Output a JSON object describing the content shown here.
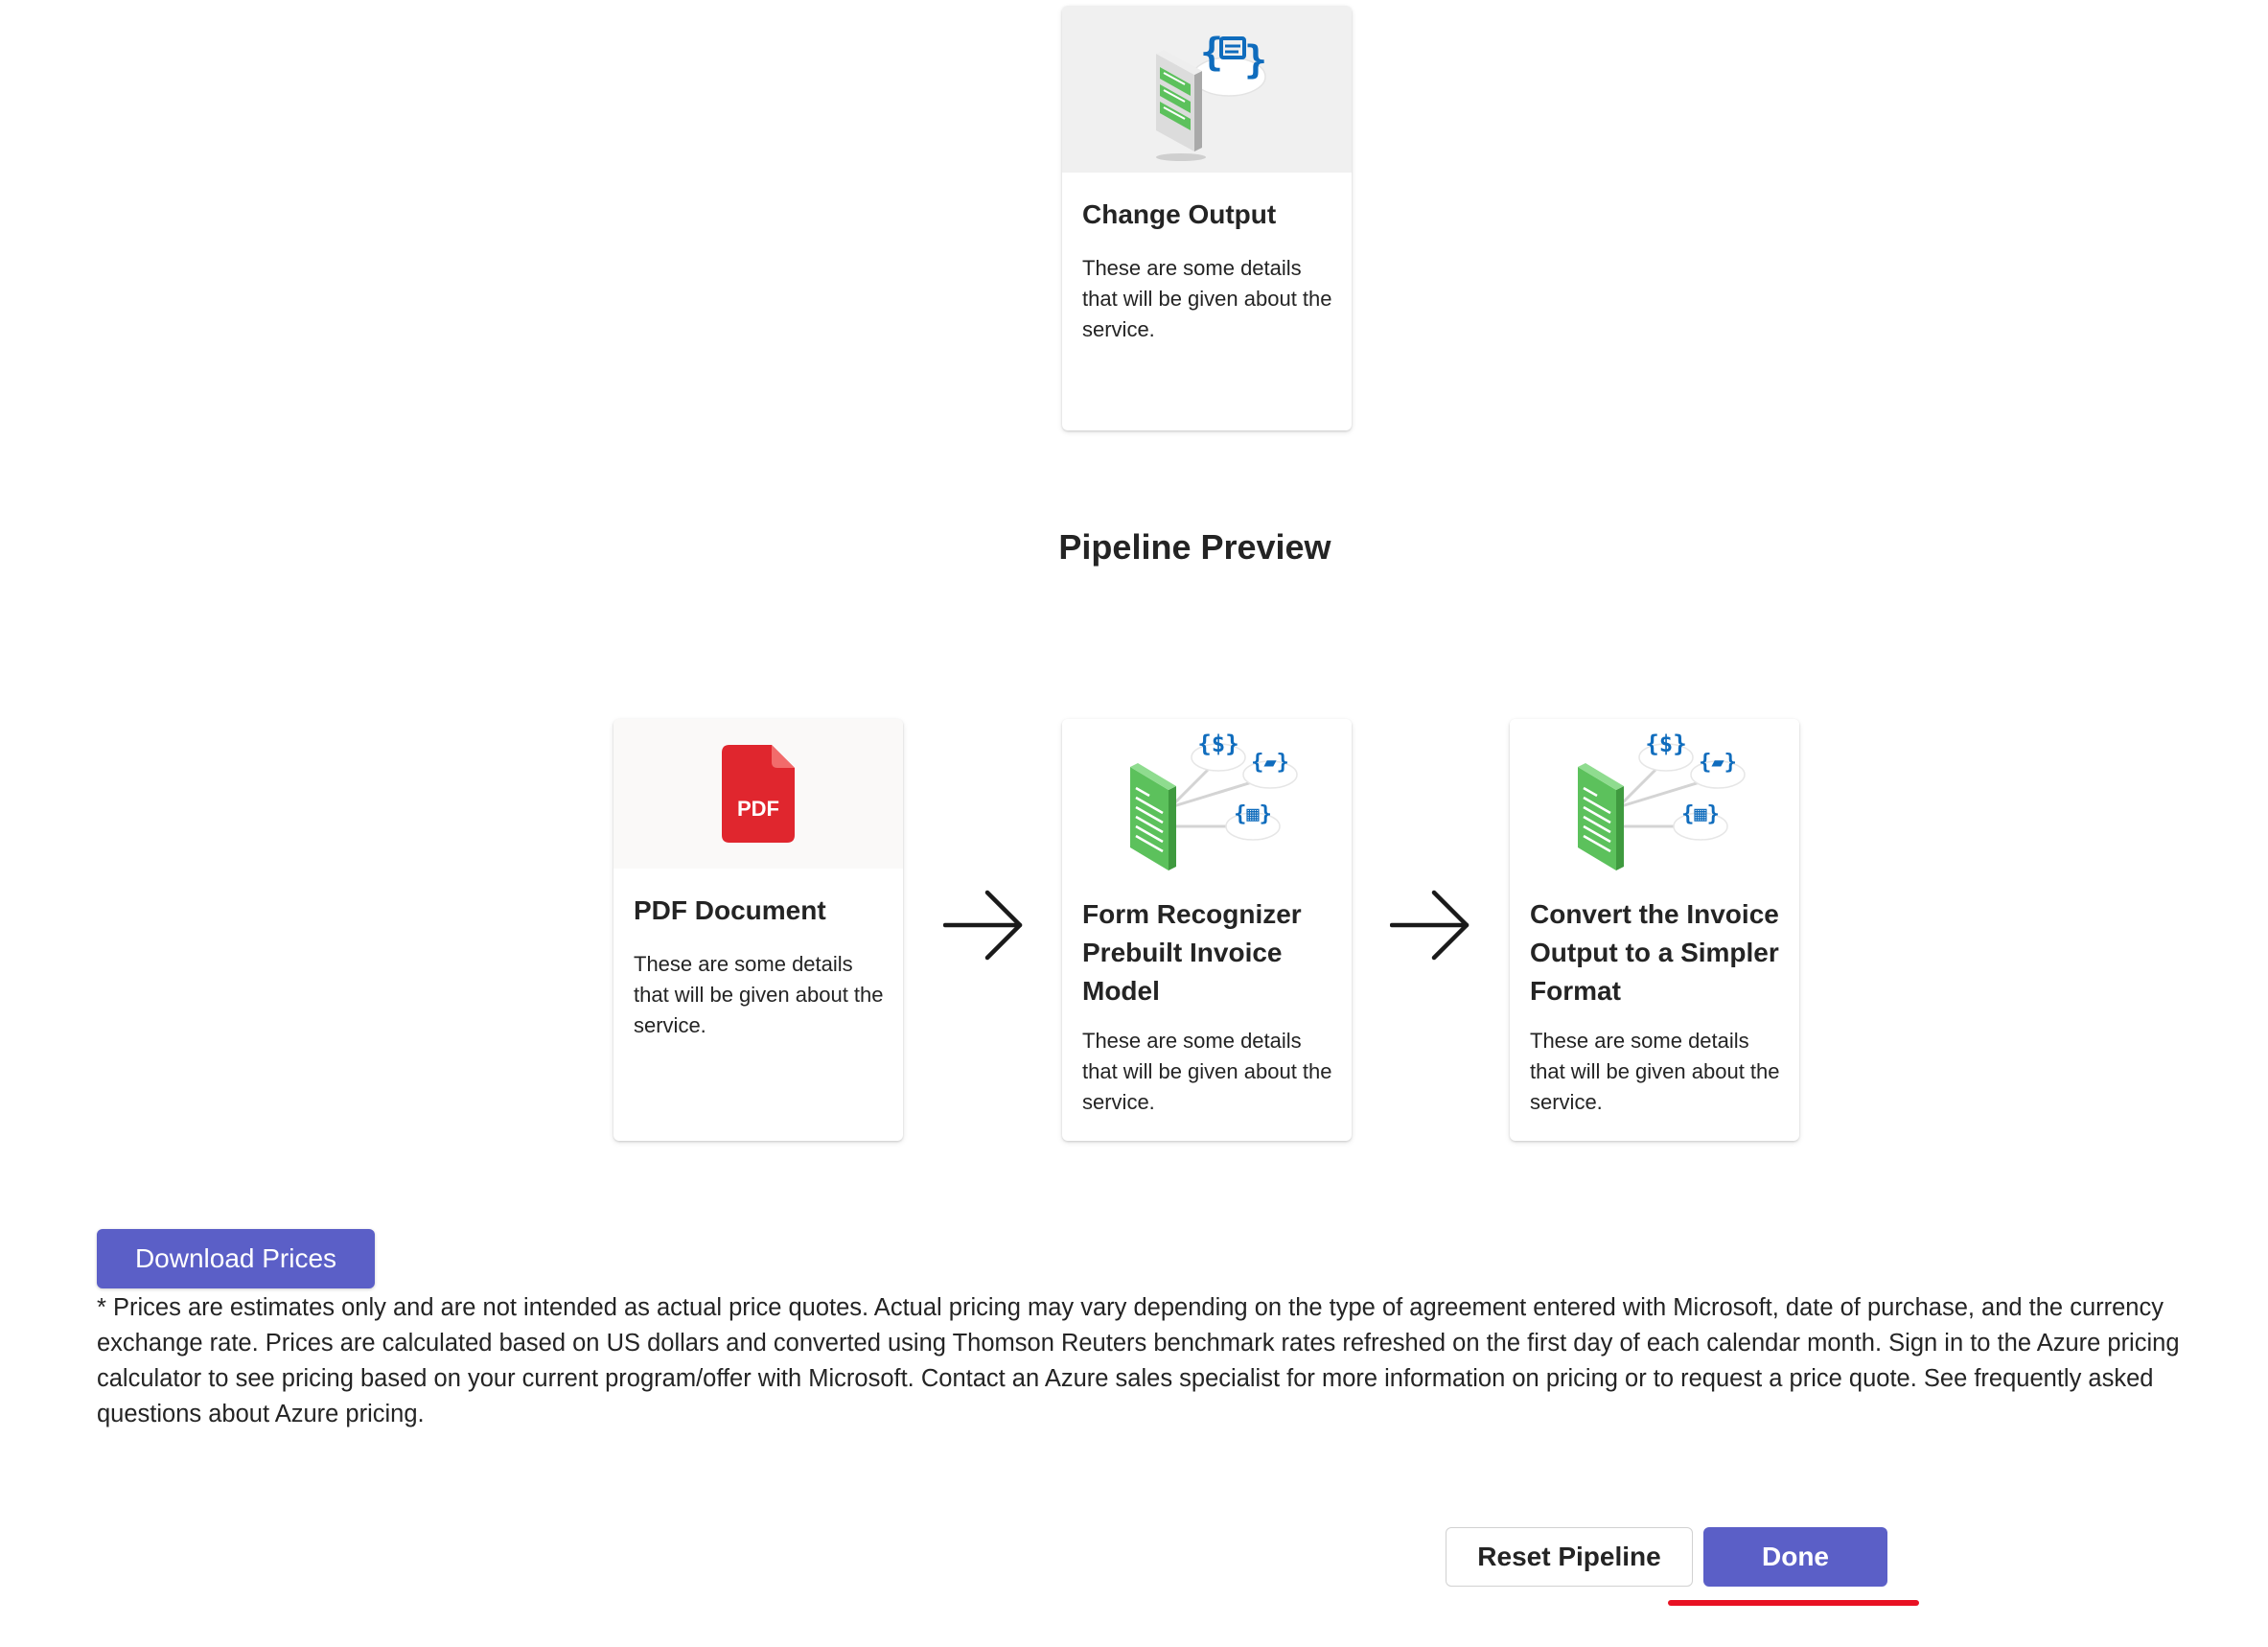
{
  "top_card": {
    "title": "Change Output",
    "description": "These are some details that will be given about the service."
  },
  "pipeline_preview": {
    "heading": "Pipeline Preview",
    "cards": [
      {
        "title": "PDF Document",
        "description": "These are some details that will be given about the service.",
        "icon_label": "PDF"
      },
      {
        "title": "Form Recognizer Prebuilt Invoice Model",
        "description": "These are some details that will be given about the service."
      },
      {
        "title": "Convert the Invoice Output to a Simpler Format",
        "description": "These are some details that will be given about the service."
      }
    ]
  },
  "actions": {
    "download_label": "Download Prices",
    "reset_label": "Reset Pipeline",
    "done_label": "Done"
  },
  "disclaimer": "* Prices are estimates only and are not intended as actual price quotes. Actual pricing may vary depending on the type of agreement entered with Microsoft, date of purchase, and the currency exchange rate. Prices are calculated based on US dollars and converted using Thomson Reuters benchmark rates refreshed on the first day of each calendar month. Sign in to the Azure pricing calculator to see pricing based on your current program/offer with Microsoft. Contact an Azure sales specialist for more information on pricing or to request a price quote. See frequently asked questions about Azure pricing.",
  "colors": {
    "primary_button": "#5b5fc7",
    "pdf_red": "#e0262e",
    "doc_green": "#5cc15c",
    "json_blue": "#0f6cbd",
    "highlight_underline": "#e81123"
  },
  "icons": {
    "change_output": "document-to-json-icon",
    "pdf": "pdf-file-icon",
    "invoice_model": "invoice-extraction-icon",
    "convert_output": "invoice-extraction-icon",
    "arrow": "arrow-right-icon"
  }
}
